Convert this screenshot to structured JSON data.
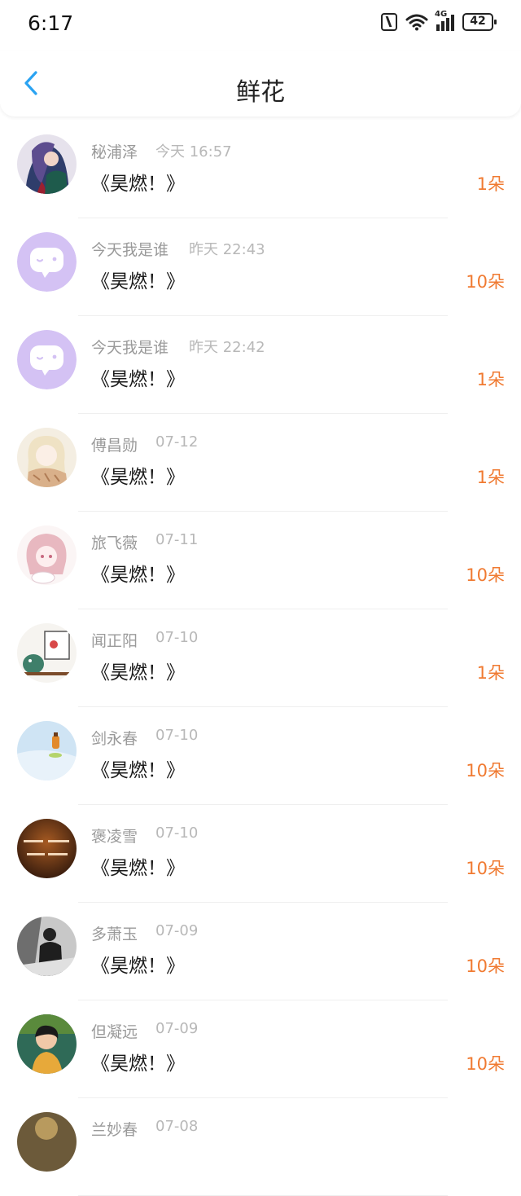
{
  "status_bar": {
    "time": "6:17",
    "network": "4G",
    "battery": "42"
  },
  "header": {
    "title": "鲜花"
  },
  "accent_color": "#2aa3f2",
  "count_color": "#f07a31",
  "items": [
    {
      "name": "秘浦泽",
      "time": "今天 16:57",
      "book": "《昊燃！》",
      "count": "1朵",
      "avatar": "anime-portrait"
    },
    {
      "name": "今天我是谁",
      "time": "昨天 22:43",
      "book": "《昊燃！》",
      "count": "10朵",
      "avatar": "chat-bubble-icon"
    },
    {
      "name": "今天我是谁",
      "time": "昨天 22:42",
      "book": "《昊燃！》",
      "count": "1朵",
      "avatar": "chat-bubble-icon"
    },
    {
      "name": "傅昌勋",
      "time": "07-12",
      "book": "《昊燃！》",
      "count": "1朵",
      "avatar": "anime-girl-scarf"
    },
    {
      "name": "旅飞薇",
      "time": "07-11",
      "book": "《昊燃！》",
      "count": "10朵",
      "avatar": "anime-girl-pink"
    },
    {
      "name": "闻正阳",
      "time": "07-10",
      "book": "《昊燃！》",
      "count": "1朵",
      "avatar": "cartoon-character"
    },
    {
      "name": "剑永春",
      "time": "07-10",
      "book": "《昊燃！》",
      "count": "10朵",
      "avatar": "bottle-photo"
    },
    {
      "name": "褒凌雪",
      "time": "07-10",
      "book": "《昊燃！》",
      "count": "10朵",
      "avatar": "text-image"
    },
    {
      "name": "多萧玉",
      "time": "07-09",
      "book": "《昊燃！》",
      "count": "10朵",
      "avatar": "bw-photo"
    },
    {
      "name": "但凝远",
      "time": "07-09",
      "book": "《昊燃！》",
      "count": "10朵",
      "avatar": "portrait-photo"
    },
    {
      "name": "兰妙春",
      "time": "07-08",
      "book": "",
      "count": "",
      "avatar": "partial-photo"
    }
  ]
}
